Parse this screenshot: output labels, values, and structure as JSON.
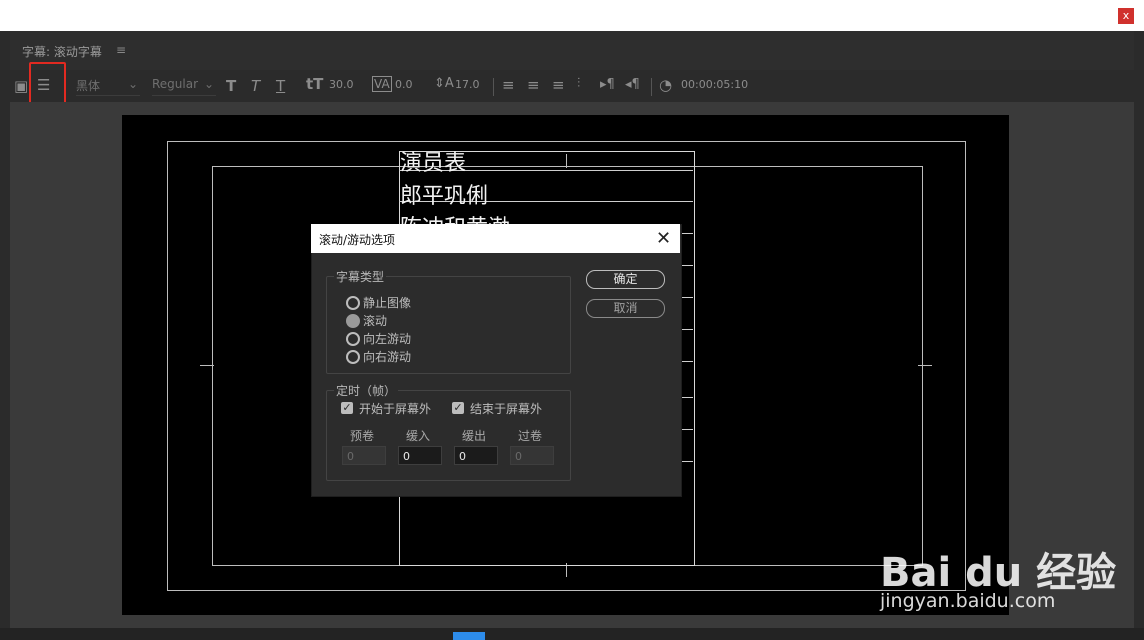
{
  "window": {
    "close_label": "x"
  },
  "panel": {
    "title": "字幕: 滚动字幕",
    "menu_icon": "hamburger-icon"
  },
  "toolbar": {
    "font_family": "黑体",
    "font_style": "Regular",
    "font_size": "30.0",
    "kerning": "0.0",
    "leading": "17.0",
    "timecode": "00:00:05:10",
    "highlight_color": "#e22a21"
  },
  "canvas": {
    "credits": [
      "演员表",
      "郎平巩俐",
      "陈冲和黄渤"
    ]
  },
  "dialog": {
    "title": "滚动/游动选项",
    "type_group": "字幕类型",
    "types": [
      "静止图像",
      "滚动",
      "向左游动",
      "向右游动"
    ],
    "selected_type": "滚动",
    "ok": "确定",
    "cancel": "取消",
    "timing_group": "定时（帧）",
    "start_offscreen": "开始于屏幕外",
    "end_offscreen": "结束于屏幕外",
    "fields": [
      {
        "label": "预卷",
        "value": "0",
        "enabled": false
      },
      {
        "label": "缓入",
        "value": "0",
        "enabled": true
      },
      {
        "label": "缓出",
        "value": "0",
        "enabled": true
      },
      {
        "label": "过卷",
        "value": "0",
        "enabled": false
      }
    ]
  },
  "watermark": {
    "brand": "Bai du 经验",
    "url": "jingyan.baidu.com"
  }
}
